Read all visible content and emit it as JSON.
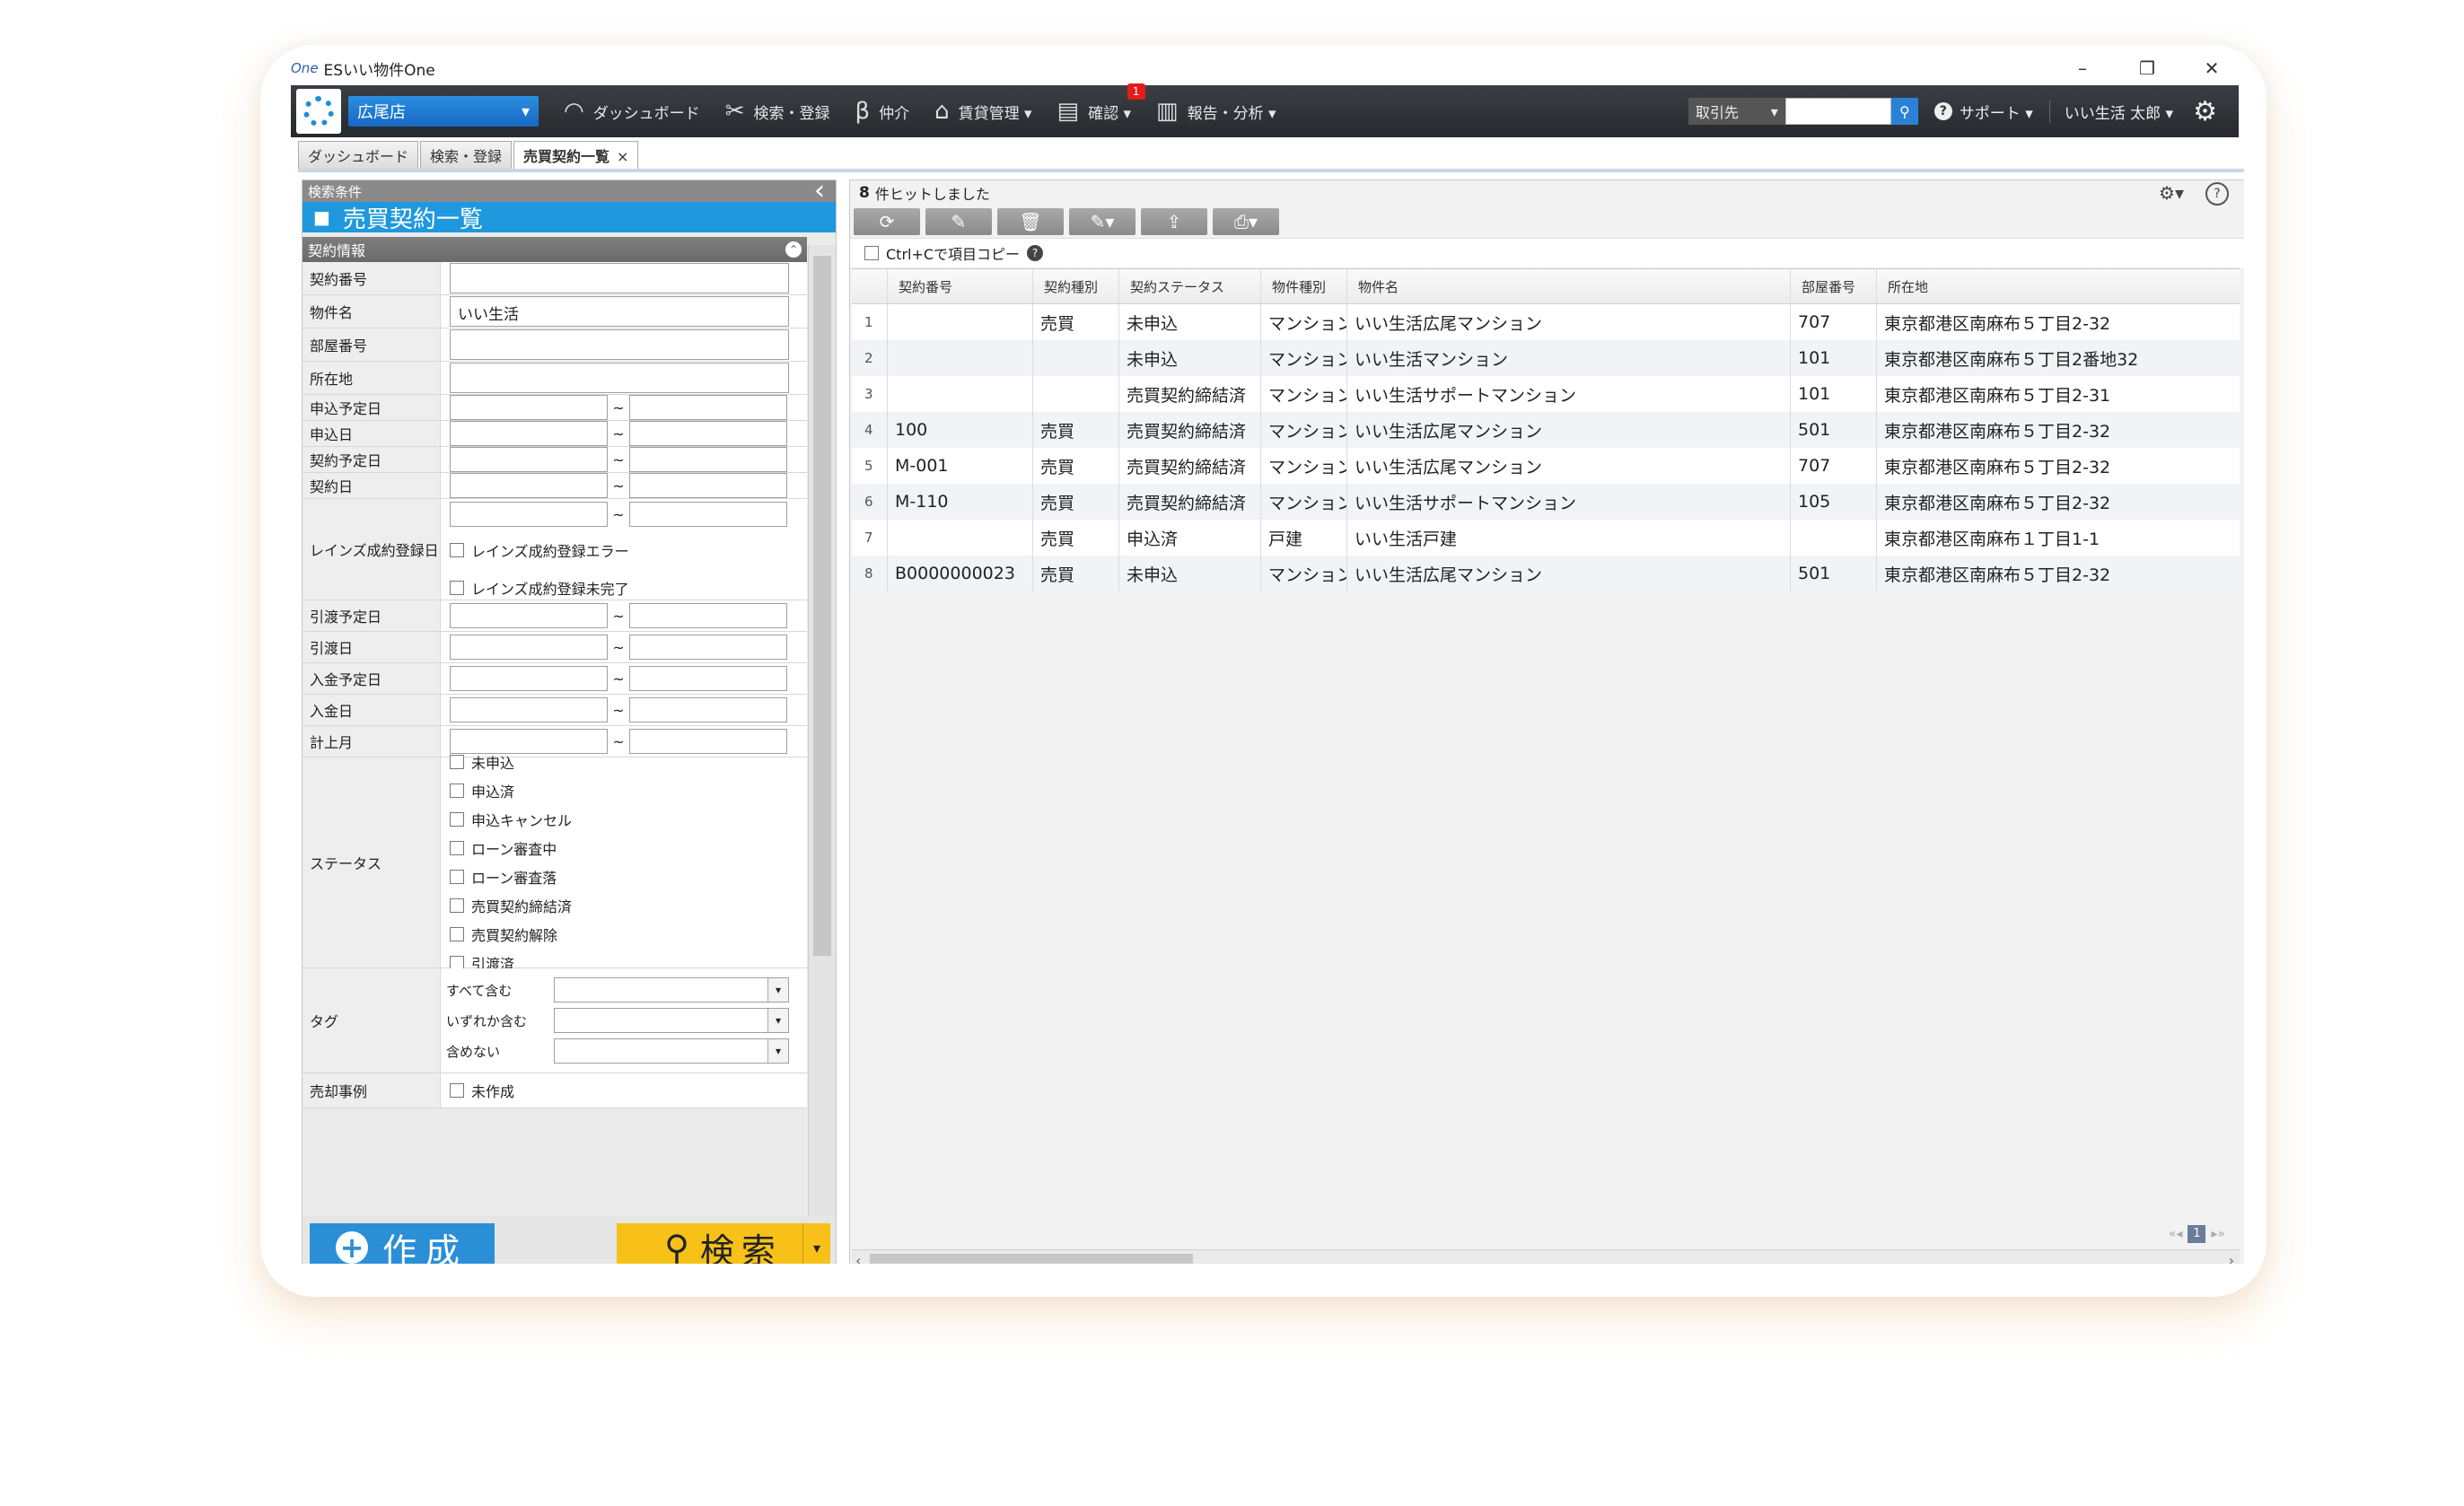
{
  "window": {
    "logo_text": "One",
    "title": "ESいい物件One",
    "controls": [
      "–",
      "❐",
      "✕"
    ]
  },
  "menubar": {
    "store": "広尾店",
    "items": [
      {
        "icon": "dashboard-icon",
        "label": "ダッシュボード"
      },
      {
        "icon": "tools-icon",
        "label": "検索・登録"
      },
      {
        "icon": "beta-icon",
        "label": "仲介"
      },
      {
        "icon": "home-icon",
        "label": "賃貸管理 ▾"
      },
      {
        "icon": "document-icon",
        "label": "確認 ▾",
        "badge": "1"
      },
      {
        "icon": "chart-icon",
        "label": "報告・分析 ▾"
      }
    ],
    "partner_select": "取引先",
    "search_value": "",
    "support": "サポート ▾",
    "user": "いい生活 太郎 ▾"
  },
  "tabs": [
    {
      "label": "ダッシュボード",
      "active": false
    },
    {
      "label": "検索・登録",
      "active": false
    },
    {
      "label": "売買契約一覧",
      "active": true,
      "close": "×"
    }
  ],
  "left": {
    "header": "検索条件",
    "banner": "売買契約一覧",
    "section_contract": "契約情報",
    "fields": {
      "contract_no": {
        "label": "契約番号",
        "value": ""
      },
      "property_name": {
        "label": "物件名",
        "value": "いい生活"
      },
      "room_no": {
        "label": "部屋番号",
        "value": ""
      },
      "address": {
        "label": "所在地",
        "value": ""
      }
    },
    "dates": {
      "apply_plan": "申込予定日",
      "apply": "申込日",
      "contract_plan": "契約予定日",
      "contract": "契約日",
      "reins": "レインズ成約登録日",
      "delivery_plan": "引渡予定日",
      "delivery": "引渡日",
      "payment_plan": "入金予定日",
      "payment": "入金日",
      "booking_month": "計上月"
    },
    "tilde": "~",
    "reins_checks": [
      "レインズ成約登録エラー",
      "レインズ成約登録未完了"
    ],
    "status_label": "ステータス",
    "statuses": [
      "未申込",
      "申込済",
      "申込キャンセル",
      "ローン審査中",
      "ローン審査落",
      "売買契約締結済",
      "売買契約解除",
      "引渡済"
    ],
    "tag_label": "タグ",
    "tag_rows": [
      "すべて含む",
      "いずれか含む",
      "含めない"
    ],
    "sale_case_label": "売却事例",
    "sale_case_check": "未作成",
    "create_button": "作成",
    "search_button": "検索"
  },
  "right": {
    "hit_count": "8",
    "hit_text": "件ヒットしました",
    "copy_label": "Ctrl+Cで項目コピー",
    "columns": [
      "契約番号",
      "契約種別",
      "契約ステータス",
      "物件種別",
      "物件名",
      "部屋番号",
      "所在地"
    ],
    "rows": [
      {
        "n": "1",
        "no": "",
        "kind": "売買",
        "status": "未申込",
        "ptype": "マンション",
        "name": "いい生活広尾マンション",
        "room": "707",
        "addr": "東京都港区南麻布５丁目2-32"
      },
      {
        "n": "2",
        "no": "",
        "kind": "",
        "status": "未申込",
        "ptype": "マンション",
        "name": "いい生活マンション",
        "room": "101",
        "addr": "東京都港区南麻布５丁目2番地32"
      },
      {
        "n": "3",
        "no": "",
        "kind": "",
        "status": "売買契約締結済",
        "ptype": "マンション",
        "name": "いい生活サポートマンション",
        "room": "101",
        "addr": "東京都港区南麻布５丁目2-31"
      },
      {
        "n": "4",
        "no": "100",
        "kind": "売買",
        "status": "売買契約締結済",
        "ptype": "マンション",
        "name": "いい生活広尾マンション",
        "room": "501",
        "addr": "東京都港区南麻布５丁目2-32"
      },
      {
        "n": "5",
        "no": "M-001",
        "kind": "売買",
        "status": "売買契約締結済",
        "ptype": "マンション",
        "name": "いい生活広尾マンション",
        "room": "707",
        "addr": "東京都港区南麻布５丁目2-32"
      },
      {
        "n": "6",
        "no": "M-110",
        "kind": "売買",
        "status": "売買契約締結済",
        "ptype": "マンション",
        "name": "いい生活サポートマンション",
        "room": "105",
        "addr": "東京都港区南麻布５丁目2-32"
      },
      {
        "n": "7",
        "no": "",
        "kind": "売買",
        "status": "申込済",
        "ptype": "戸建",
        "name": "いい生活戸建",
        "room": "",
        "addr": "東京都港区南麻布１丁目1-1"
      },
      {
        "n": "8",
        "no": "B0000000023",
        "kind": "売買",
        "status": "未申込",
        "ptype": "マンション",
        "name": "いい生活広尾マンション",
        "room": "501",
        "addr": "東京都港区南麻布５丁目2-32"
      }
    ],
    "page": "1"
  },
  "colors": {
    "accent": "#1f98de",
    "search_button": "#f7c117",
    "menubar": "#2b2e33",
    "badge": "#e31b1b"
  }
}
